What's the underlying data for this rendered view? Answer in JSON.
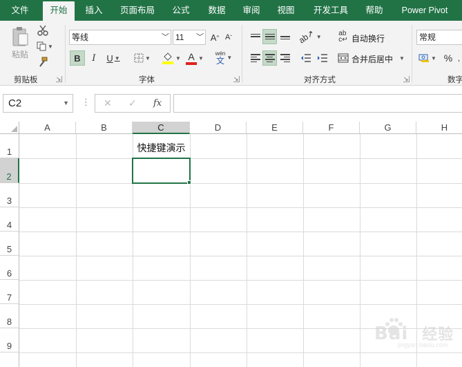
{
  "tabs": [
    {
      "label": "文件",
      "active": false
    },
    {
      "label": "开始",
      "active": true
    },
    {
      "label": "插入",
      "active": false
    },
    {
      "label": "页面布局",
      "active": false
    },
    {
      "label": "公式",
      "active": false
    },
    {
      "label": "数据",
      "active": false
    },
    {
      "label": "审阅",
      "active": false
    },
    {
      "label": "视图",
      "active": false
    },
    {
      "label": "开发工具",
      "active": false
    },
    {
      "label": "帮助",
      "active": false
    },
    {
      "label": "Power Pivot",
      "active": false
    }
  ],
  "ribbon": {
    "clipboard": {
      "paste_label": "粘贴",
      "group_label": "剪贴板"
    },
    "font": {
      "font_name": "等线",
      "font_size": "11",
      "grow_label": "A",
      "shrink_label": "A",
      "bold_label": "B",
      "italic_label": "I",
      "underline_label": "U",
      "font_color_label": "A",
      "phonetic_label": "wén",
      "phonetic_char": "文",
      "group_label": "字体"
    },
    "alignment": {
      "wrap_text_label": "自动换行",
      "merge_label": "合并后居中",
      "group_label": "对齐方式"
    },
    "number": {
      "format": "常规",
      "percent_label": "%",
      "group_label": "数字"
    }
  },
  "formula_bar": {
    "name_box": "C2",
    "cancel": "✕",
    "enter": "✓",
    "fx": "fx",
    "formula": ""
  },
  "grid": {
    "columns": [
      "A",
      "B",
      "C",
      "D",
      "E",
      "F",
      "G",
      "H"
    ],
    "rows": [
      "1",
      "2",
      "3",
      "4",
      "5",
      "6",
      "7",
      "8",
      "9"
    ],
    "selected_column": "C",
    "selected_row": "2",
    "cells": {
      "C1": "快捷键演示"
    }
  },
  "watermark": {
    "text": "Bai",
    "suffix": "经验",
    "sub": "jingyan.baidu.com"
  },
  "colors": {
    "accent": "#217346",
    "selection_fill": "#c5d9c9",
    "header_selected": "#d2d2d2"
  }
}
